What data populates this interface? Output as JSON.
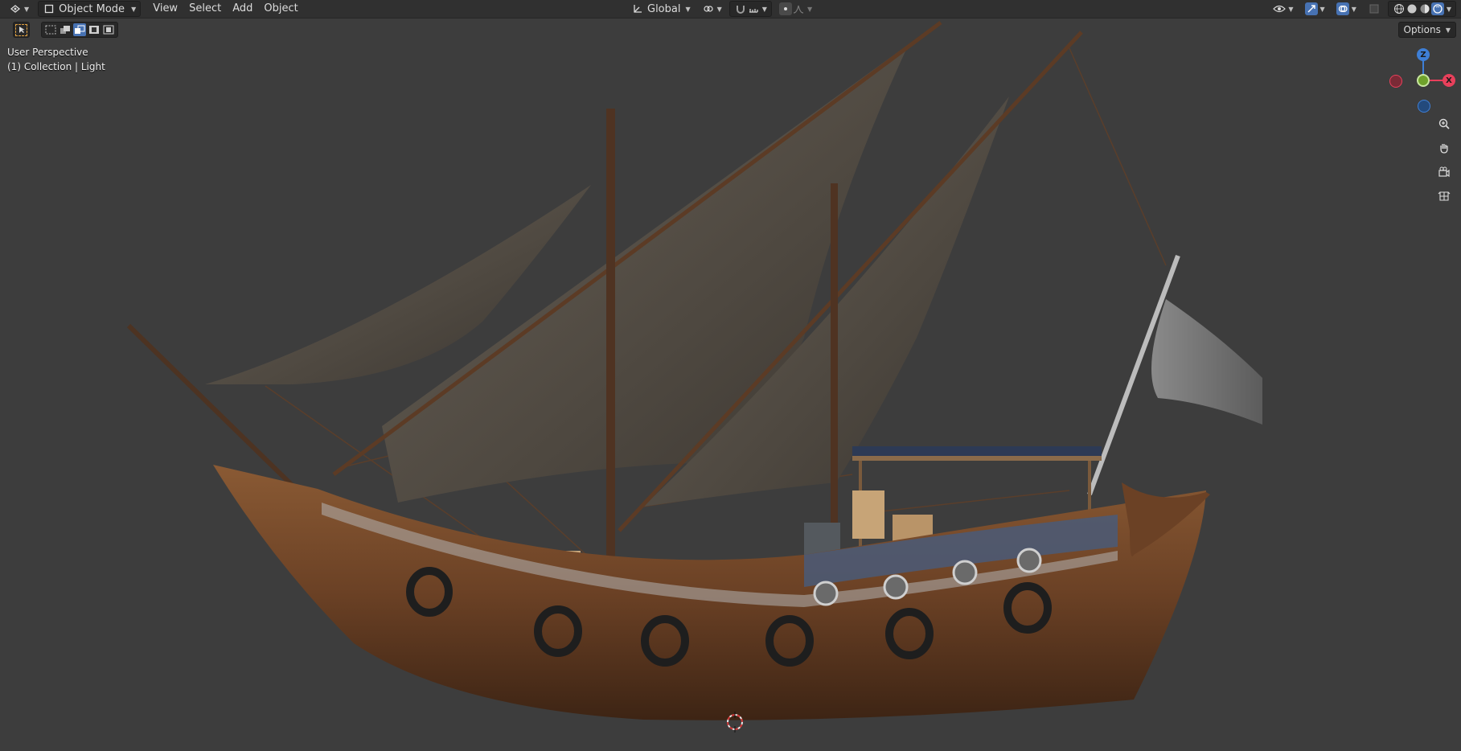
{
  "header": {
    "mode_label": "Object Mode",
    "menus": [
      "View",
      "Select",
      "Add",
      "Object"
    ],
    "transform_orientation": "Global"
  },
  "viewport": {
    "perspective_label": "User Perspective",
    "collection_label": "(1) Collection | Light",
    "options_label": "Options"
  },
  "gizmo": {
    "z_label": "Z",
    "x_label": "X"
  },
  "colors": {
    "accent": "#4772b3",
    "axis_x": "#e8405b",
    "axis_y": "#6fa22b",
    "axis_z": "#3e7fd6",
    "background": "#3d3d3d",
    "header": "#303030"
  },
  "icons": {
    "editor_type": "3d-viewport-icon",
    "navigation": [
      "zoom-icon",
      "pan-hand-icon",
      "camera-icon",
      "grid-ortho-icon"
    ]
  }
}
